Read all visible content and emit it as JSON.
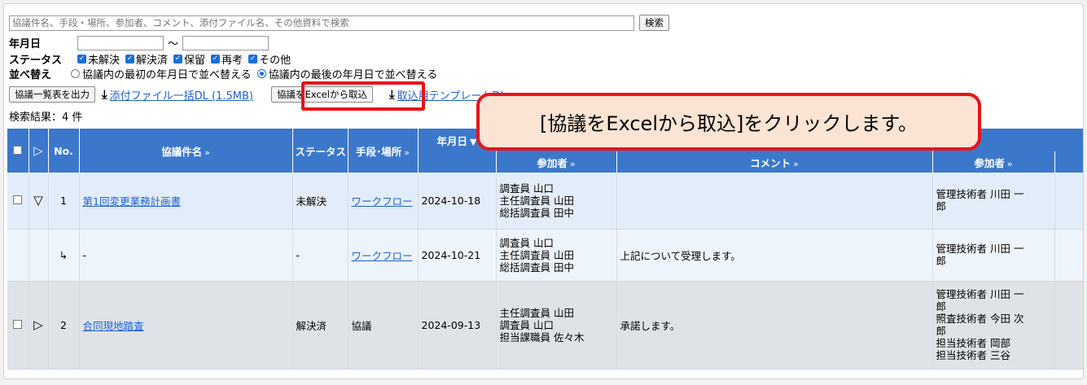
{
  "search": {
    "placeholder": "協議件名、手段・場所、参加者、コメント、添付ファイル名、その他資料で検索",
    "button": "検索"
  },
  "filters": {
    "date_label": "年月日",
    "date_sep": "～",
    "status_label": "ステータス",
    "status_options": [
      "未解決",
      "解決済",
      "保留",
      "再考",
      "その他"
    ],
    "sort_label": "並べ替え",
    "sort_options": [
      "協議内の最初の年月日で並べ替える",
      "協議内の最後の年月日で並べ替える"
    ]
  },
  "toolbar": {
    "export_list": "協議一覧表を出力",
    "attach_dl": "添付ファイル一括DL (1.5MB)",
    "import_excel": "協議をExcelから取込",
    "import_template": "取込用テンプレートDL"
  },
  "results": {
    "count_text": "検索結果：4 件"
  },
  "callout": {
    "text": "[協議をExcelから取込]をクリックします。"
  },
  "table": {
    "headers": {
      "no": "No.",
      "title": "協議件名",
      "status": "ステータス",
      "method": "手段･場所",
      "date": "年月日",
      "participants": "参加者",
      "comment": "コメント",
      "participants2": "参加者"
    },
    "sort_arrow": "»",
    "rows": [
      {
        "no": "1",
        "title": "第1回変更業務計画書",
        "status": "未解決",
        "method": "ワークフロー",
        "date": "2024-10-18",
        "participants": "調査員 山口\n主任調査員 山田\n総括調査員 田中",
        "comment": "",
        "participants2": "管理技術者 川田 一\n郎"
      },
      {
        "no": "↳",
        "title": "-",
        "status": "-",
        "method": "ワークフロー",
        "date": "2024-10-21",
        "participants": "調査員 山口\n主任調査員 山田\n総括調査員 田中",
        "comment": "上記について受理します。",
        "participants2": "管理技術者 川田 一\n郎"
      },
      {
        "no": "2",
        "title": "合同現地踏査",
        "status": "解決済",
        "method": "協議",
        "date": "2024-09-13",
        "participants": "主任調査員 山田\n調査員 山口\n担当課職員 佐々木",
        "comment": "承諾します。",
        "participants2": "管理技術者 川田 一\n郎\n照査技術者 今田 次\n郎\n担当技術者 岡部\n担当技術者 三谷"
      }
    ]
  },
  "colors": {
    "header_bg": "#3b78cc",
    "highlight": "#e8141b",
    "callout_bg": "#fbe4d4",
    "link": "#1f5fd1"
  }
}
